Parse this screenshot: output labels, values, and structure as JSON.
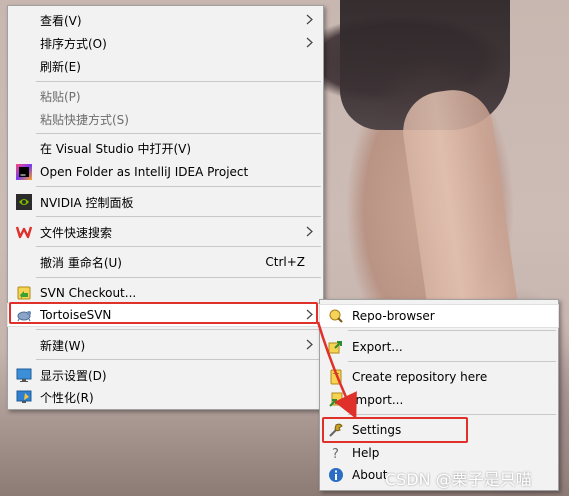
{
  "main_menu": {
    "items": [
      {
        "label": "查看(V)"
      },
      {
        "label": "排序方式(O)"
      },
      {
        "label": "刷新(E)"
      },
      {
        "label": "粘贴(P)"
      },
      {
        "label": "粘贴快捷方式(S)"
      },
      {
        "label": "在 Visual Studio 中打开(V)"
      },
      {
        "label": "Open Folder as IntelliJ IDEA Project"
      },
      {
        "label": "NVIDIA 控制面板"
      },
      {
        "label": "文件快速搜索"
      },
      {
        "label": "撤消 重命名(U)",
        "shortcut": "Ctrl+Z"
      },
      {
        "label": "SVN Checkout..."
      },
      {
        "label": "TortoiseSVN"
      },
      {
        "label": "新建(W)"
      },
      {
        "label": "显示设置(D)"
      },
      {
        "label": "个性化(R)"
      }
    ]
  },
  "sub_menu": {
    "items": [
      {
        "label": "Repo-browser"
      },
      {
        "label": "Export..."
      },
      {
        "label": "Create repository here"
      },
      {
        "label": "Import..."
      },
      {
        "label": "Settings"
      },
      {
        "label": "Help"
      },
      {
        "label": "About"
      }
    ]
  },
  "watermark": "CSDN @栗子是只喵",
  "colors": {
    "highlight_box": "#e0302a",
    "menu_bg": "#f2f2f2"
  }
}
